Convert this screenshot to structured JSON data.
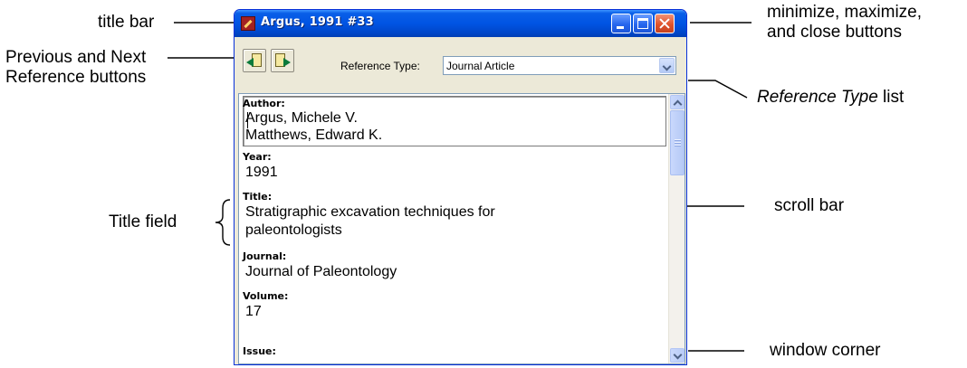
{
  "annotations": {
    "title_bar": "title bar",
    "prev_next": [
      "Previous and Next",
      "Reference buttons"
    ],
    "window_buttons": [
      "minimize, maximize,",
      "and close buttons"
    ],
    "reference_type_list": {
      "italic": "Reference Type",
      "plain": " list"
    },
    "scroll_bar": "scroll bar",
    "title_field": "Title field",
    "window_corner": "window corner"
  },
  "window": {
    "title": "Argus, 1991 #33",
    "buttons": {
      "minimize": "minimize",
      "maximize": "maximize",
      "close": "close"
    }
  },
  "toolbar": {
    "prev_button": "Previous Reference",
    "next_button": "Next Reference",
    "reference_type_label": "Reference Type:",
    "reference_type_value": "Journal Article"
  },
  "fields": {
    "author": {
      "label": "Author:",
      "values": [
        "Argus, Michele V.",
        "Matthews, Edward K."
      ]
    },
    "year": {
      "label": "Year:",
      "value": "1991"
    },
    "title": {
      "label": "Title:",
      "values": [
        "Stratigraphic excavation techniques for",
        "paleontologists"
      ]
    },
    "journal": {
      "label": "Journal:",
      "value": "Journal of Paleontology"
    },
    "volume": {
      "label": "Volume:",
      "value": "17"
    },
    "issue": {
      "label": "Issue:",
      "value": ""
    }
  },
  "icons": [
    "app-icon",
    "previous-reference-icon",
    "next-reference-icon",
    "dropdown-arrow-icon",
    "scroll-up-icon",
    "scroll-down-icon"
  ],
  "colors": {
    "titlebar": "#0054e3",
    "close_button": "#e0532b",
    "window_face": "#ece9d8"
  }
}
